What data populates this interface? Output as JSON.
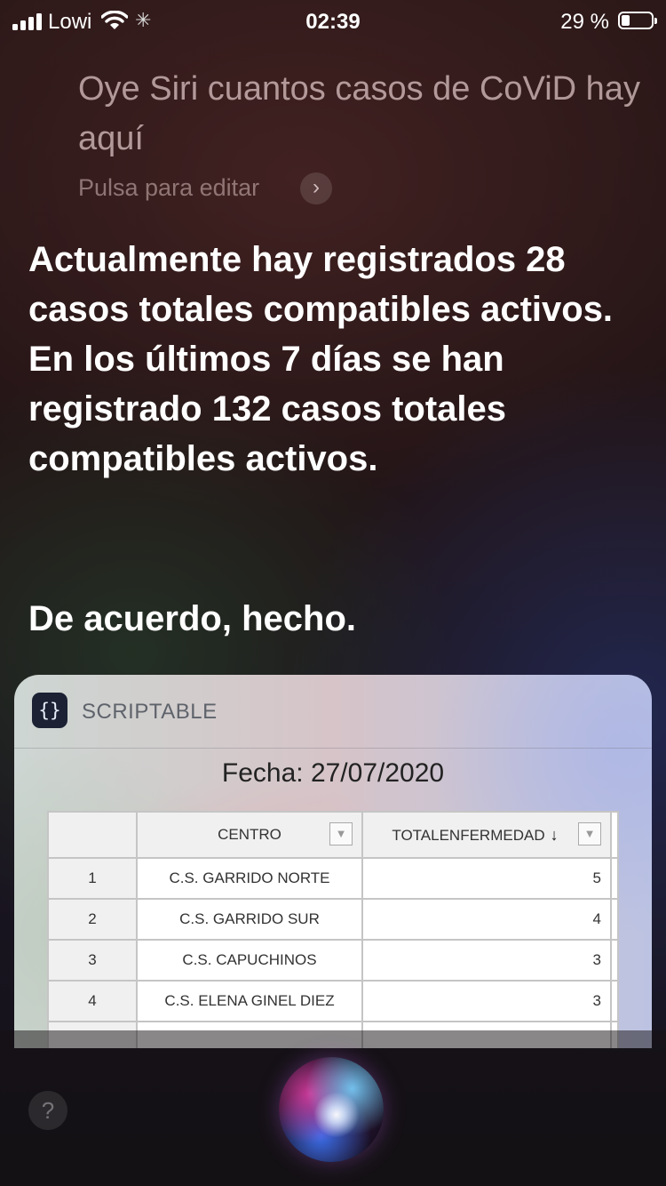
{
  "status_bar": {
    "carrier": "Lowi",
    "time": "02:39",
    "battery_percent": "29 %",
    "battery_level": 0.29,
    "icons": [
      "signal-icon",
      "wifi-icon",
      "activity-icon",
      "battery-icon"
    ]
  },
  "siri": {
    "query": "Oye Siri cuantos casos de CoViD hay aquí",
    "edit_hint": "Pulsa para editar",
    "edit_chevron": "›",
    "response": "Actualmente hay registrados 28 casos totales compatibles activos.\nEn los últimos 7 días se han registrado 132 casos totales compatibles activos.",
    "done": "De acuerdo, hecho.",
    "help": "?"
  },
  "card": {
    "app_icon": "{}",
    "app_name": "SCRIPTABLE",
    "date": "Fecha: 27/07/2020",
    "table": {
      "headers": {
        "centro": "CENTRO",
        "total": "TOTALENFERMEDAD",
        "sort_icon": "↓",
        "filter_icon": "▼"
      },
      "rows": [
        {
          "idx": "1",
          "centro": "C.S. GARRIDO NORTE",
          "total": "5"
        },
        {
          "idx": "2",
          "centro": "C.S. GARRIDO SUR",
          "total": "4"
        },
        {
          "idx": "3",
          "centro": "C.S. CAPUCHINOS",
          "total": "3"
        },
        {
          "idx": "4",
          "centro": "C.S. ELENA GINEL DIEZ",
          "total": "3"
        },
        {
          "idx": "",
          "centro": "",
          "total": ""
        }
      ]
    }
  }
}
